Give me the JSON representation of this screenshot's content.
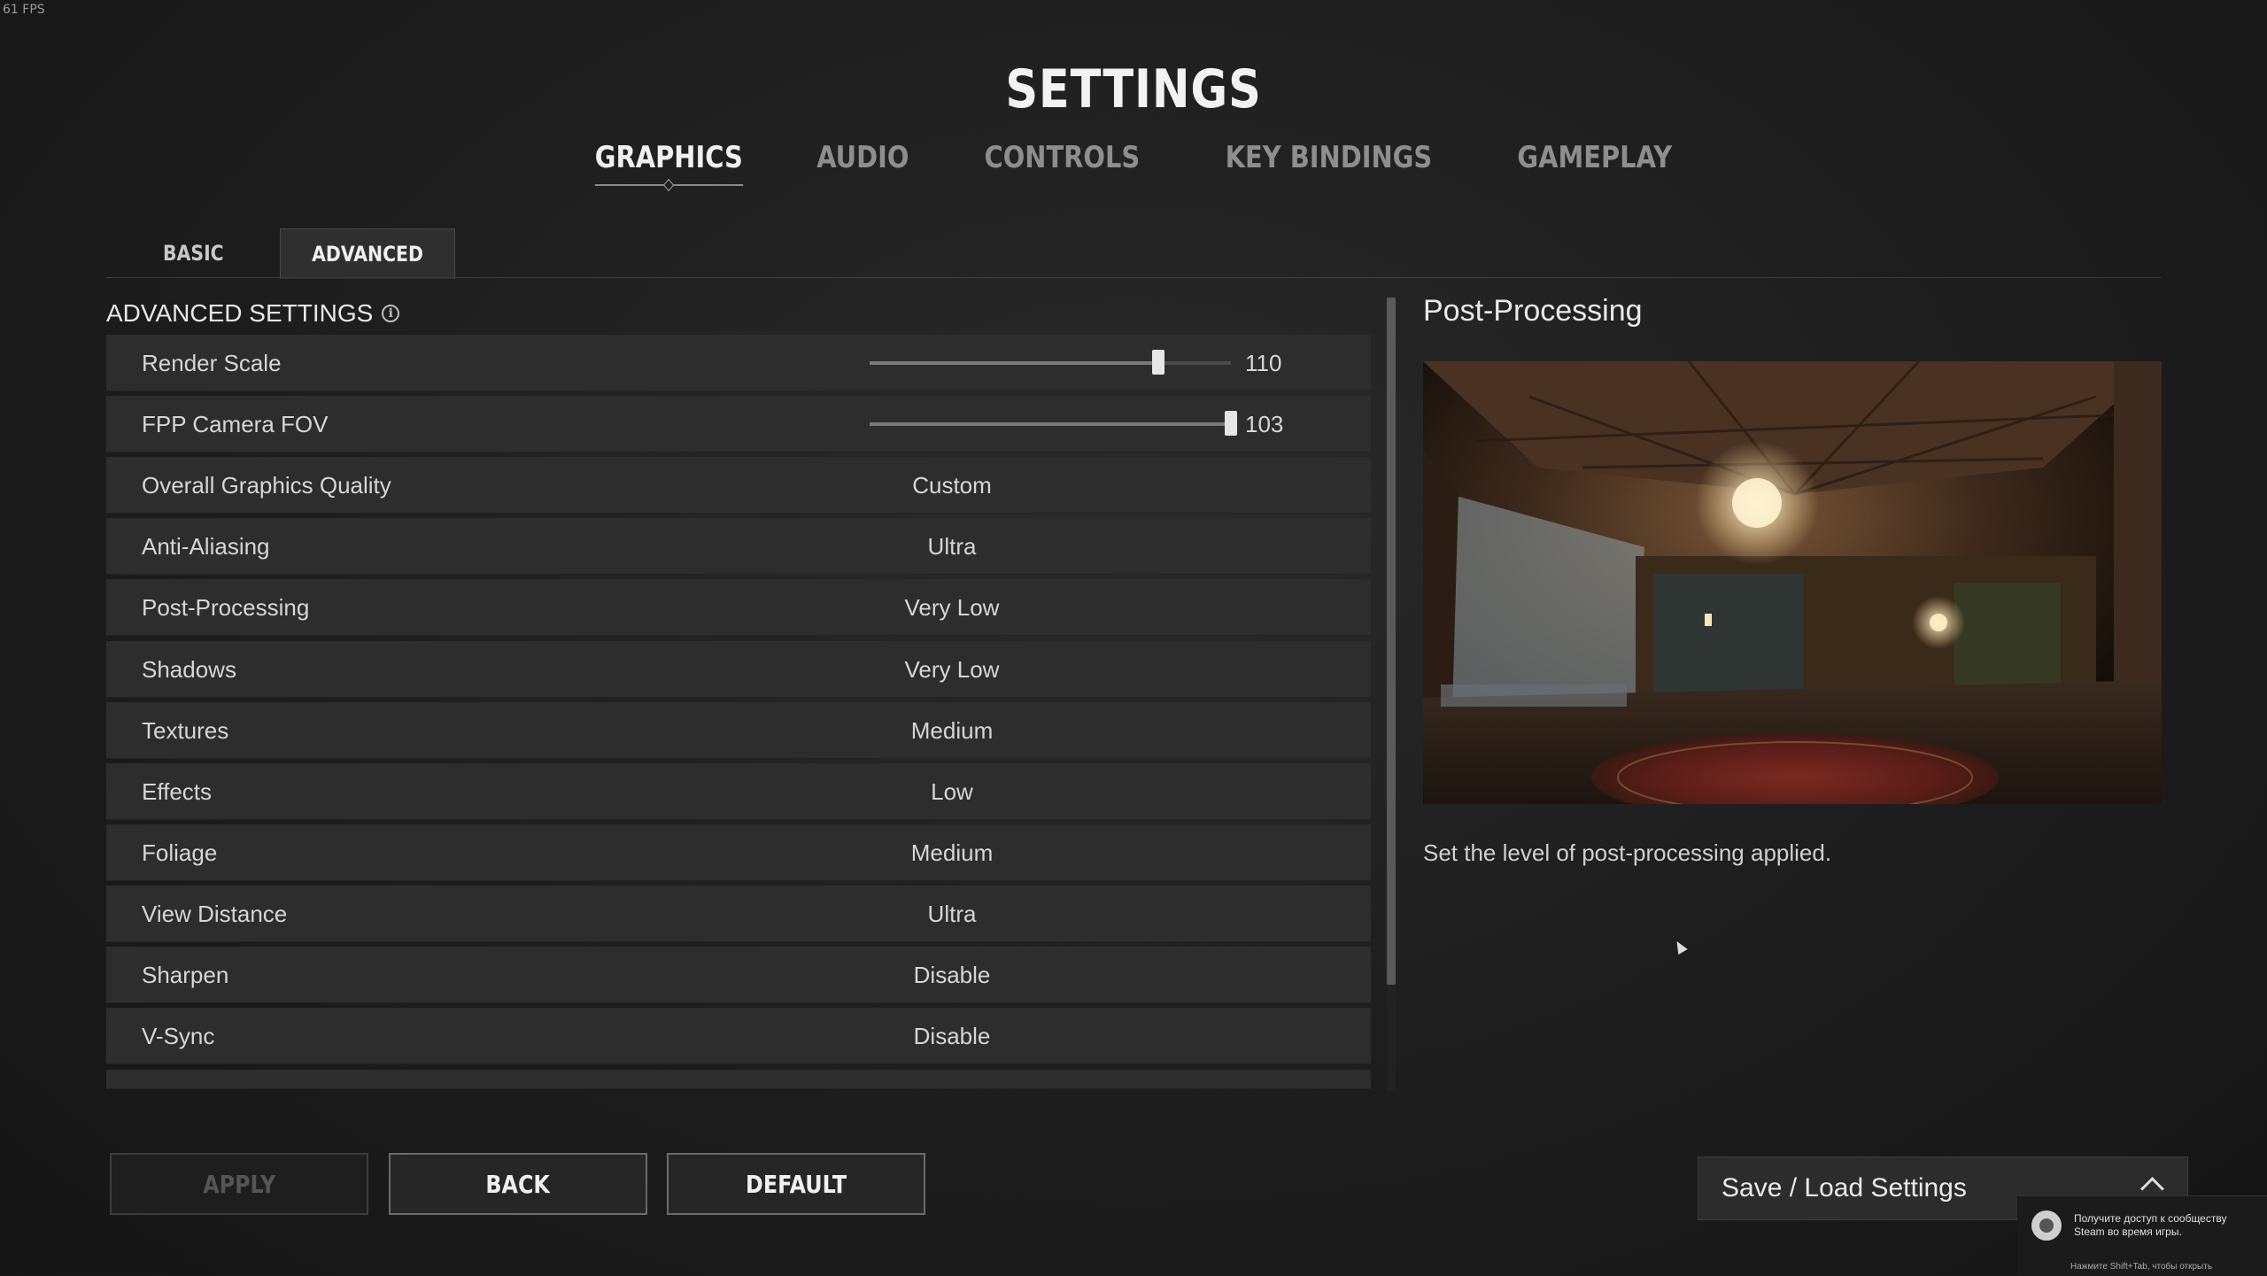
{
  "fps_counter": "61 FPS",
  "title": "SETTINGS",
  "main_tabs": [
    "GRAPHICS",
    "AUDIO",
    "CONTROLS",
    "KEY BINDINGS",
    "GAMEPLAY"
  ],
  "active_main_tab": "GRAPHICS",
  "sub_tabs": [
    "BASIC",
    "ADVANCED"
  ],
  "active_sub_tab": "ADVANCED",
  "section_heading": "ADVANCED SETTINGS",
  "settings": {
    "render_scale": {
      "label": "Render Scale",
      "value": "110",
      "slider_fraction": 0.8
    },
    "fpp_fov": {
      "label": "FPP Camera FOV",
      "value": "103",
      "slider_fraction": 1.0
    },
    "overall_quality": {
      "label": "Overall Graphics Quality",
      "value": "Custom"
    },
    "anti_aliasing": {
      "label": "Anti-Aliasing",
      "value": "Ultra"
    },
    "post_processing": {
      "label": "Post-Processing",
      "value": "Very Low"
    },
    "shadows": {
      "label": "Shadows",
      "value": "Very Low"
    },
    "textures": {
      "label": "Textures",
      "value": "Medium"
    },
    "effects": {
      "label": "Effects",
      "value": "Low"
    },
    "foliage": {
      "label": "Foliage",
      "value": "Medium"
    },
    "view_distance": {
      "label": "View Distance",
      "value": "Ultra"
    },
    "sharpen": {
      "label": "Sharpen",
      "value": "Disable"
    },
    "vsync": {
      "label": "V-Sync",
      "value": "Disable"
    }
  },
  "detail": {
    "title": "Post-Processing",
    "description": "Set the level of post-processing applied."
  },
  "buttons": {
    "apply": "APPLY",
    "back": "BACK",
    "default": "DEFAULT"
  },
  "save_load": {
    "label": "Save / Load Settings"
  },
  "steam_overlay": {
    "text": "Получите доступ к сообществу Steam во время игры.",
    "hint": "Нажмите Shift+Tab, чтобы открыть"
  },
  "icons": [
    "info-icon",
    "chevron-up-icon",
    "steam-icon",
    "mouse-cursor-icon"
  ]
}
